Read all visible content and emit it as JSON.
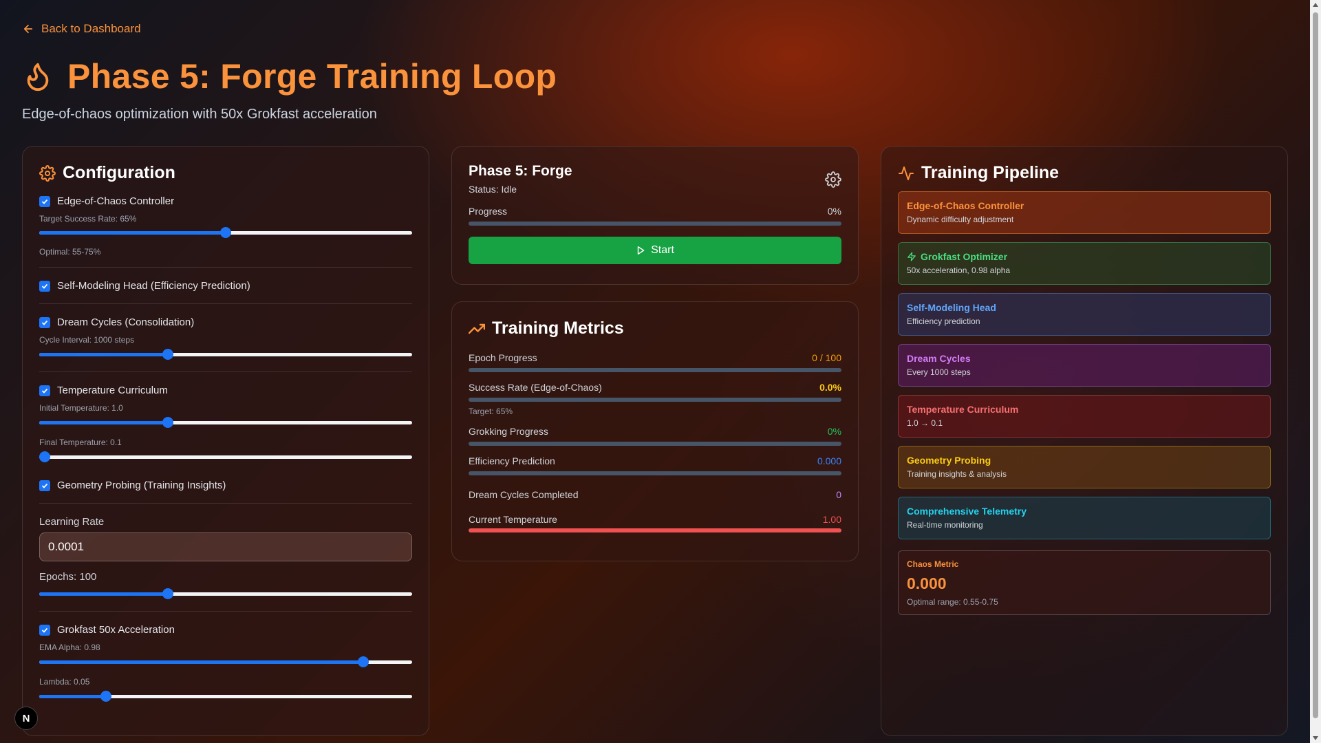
{
  "nav": {
    "back_label": "Back to Dashboard"
  },
  "header": {
    "title": "Phase 5: Forge Training Loop",
    "subtitle": "Edge-of-chaos optimization with 50x Grokfast acceleration"
  },
  "config": {
    "heading": "Configuration",
    "edge_of_chaos": {
      "label": "Edge-of-Chaos Controller",
      "checked": true,
      "rate_label": "Target Success Rate: 65%",
      "rate_fraction": 0.5,
      "optimal_note": "Optimal: 55-75%"
    },
    "self_modeling": {
      "label": "Self-Modeling Head (Efficiency Prediction)",
      "checked": true
    },
    "dream_cycles": {
      "label": "Dream Cycles (Consolidation)",
      "checked": true,
      "interval_label": "Cycle Interval: 1000 steps",
      "interval_fraction": 0.34
    },
    "temperature": {
      "label": "Temperature Curriculum",
      "checked": true,
      "initial_label": "Initial Temperature: 1.0",
      "initial_fraction": 0.34,
      "final_label": "Final Temperature: 0.1",
      "final_fraction": 0.0
    },
    "geometry": {
      "label": "Geometry Probing (Training Insights)",
      "checked": true
    },
    "learning_rate": {
      "label": "Learning Rate",
      "value": "0.0001"
    },
    "epochs": {
      "label": "Epochs: 100",
      "fraction": 0.34
    },
    "grokfast": {
      "label": "Grokfast 50x Acceleration",
      "checked": true,
      "alpha_label": "EMA Alpha: 0.98",
      "alpha_fraction": 0.88,
      "lambda_label": "Lambda: 0.05",
      "lambda_fraction": 0.17
    }
  },
  "phase_card": {
    "name": "Phase 5: Forge",
    "status": "Status: Idle",
    "progress_label": "Progress",
    "progress_value": "0%",
    "progress_fraction": 0,
    "start_label": "Start"
  },
  "metrics": {
    "heading": "Training Metrics",
    "epoch": {
      "label": "Epoch Progress",
      "value": "0 / 100",
      "fraction": 0,
      "color": "#f59e0b"
    },
    "success": {
      "label": "Success Rate (Edge-of-Chaos)",
      "value": "0.0%",
      "fraction": 0,
      "target": "Target: 65%",
      "color": "#facc15"
    },
    "grokking": {
      "label": "Grokking Progress",
      "value": "0%",
      "fraction": 0,
      "color": "#22c55e"
    },
    "efficiency": {
      "label": "Efficiency Prediction",
      "value": "0.000",
      "fraction": 0,
      "color": "#3b82f6"
    },
    "dream": {
      "label": "Dream Cycles Completed",
      "value": "0",
      "color": "#c084fc"
    },
    "temperature": {
      "label": "Current Temperature",
      "value": "1.00",
      "fraction": 1.0,
      "color": "#f05252"
    }
  },
  "pipeline": {
    "heading": "Training Pipeline",
    "stages": [
      {
        "title": "Edge-of-Chaos Controller",
        "desc": "Dynamic difficulty adjustment",
        "color": "#fb923c",
        "bg": "rgba(154,52,18,0.55)",
        "border": "rgba(251,146,60,0.45)"
      },
      {
        "title": "Grokfast Optimizer",
        "desc": "50x acceleration, 0.98 alpha",
        "color": "#4ade80",
        "bg": "rgba(40,80,40,0.5)",
        "border": "rgba(74,222,128,0.35)"
      },
      {
        "title": "Self-Modeling Head",
        "desc": "Efficiency prediction",
        "color": "#60a5fa",
        "bg": "rgba(45,55,100,0.55)",
        "border": "rgba(96,165,250,0.35)"
      },
      {
        "title": "Dream Cycles",
        "desc": "Every 1000 steps",
        "color": "#d17cf5",
        "bg": "rgba(95,30,105,0.55)",
        "border": "rgba(192,132,252,0.35)"
      },
      {
        "title": "Temperature Curriculum",
        "desc": "1.0 → 0.1",
        "color": "#f87171",
        "bg": "rgba(110,22,26,0.55)",
        "border": "rgba(248,113,113,0.35)"
      },
      {
        "title": "Geometry Probing",
        "desc": "Training insights & analysis",
        "color": "#facc15",
        "bg": "rgba(110,65,20,0.55)",
        "border": "rgba(250,204,21,0.35)"
      },
      {
        "title": "Comprehensive Telemetry",
        "desc": "Real-time monitoring",
        "color": "#22d3ee",
        "bg": "rgba(25,65,80,0.55)",
        "border": "rgba(34,211,238,0.35)"
      }
    ],
    "chaos": {
      "label": "Chaos Metric",
      "value": "0.000",
      "range": "Optimal range: 0.55-0.75"
    }
  },
  "badge": {
    "letter": "N"
  },
  "colors": {
    "accent": "#fb923c",
    "primary": "#1d74f5",
    "success": "#17a243"
  },
  "icons": [
    "arrow-left-icon",
    "flame-icon",
    "gear-icon",
    "trending-up-icon",
    "activity-icon",
    "zap-icon",
    "play-icon",
    "check-icon"
  ]
}
